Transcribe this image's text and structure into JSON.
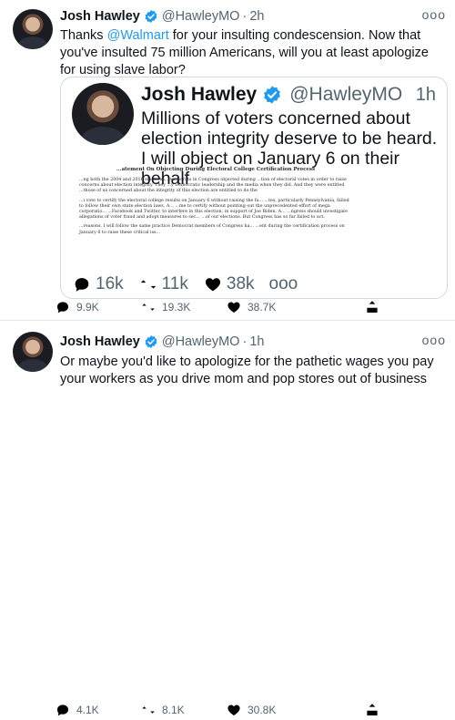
{
  "colors": {
    "link": "#1d9bf0",
    "verified": "#1d9bf0",
    "muted": "#536471",
    "text": "#0f1419"
  },
  "tweets": [
    {
      "name": "Josh Hawley",
      "handle": "@HawleyMO",
      "dot": "·",
      "time": "2h",
      "more": "ooo",
      "text_before": "Thanks ",
      "mention": "@Walmart",
      "text_after": " for your insulting condescension. Now that you've insulted 75 million Americans, will you at least apologize for using slave labor?",
      "quote": {
        "name": "Josh Hawley",
        "handle": "@HawleyMO",
        "time": "1h",
        "text": "Millions of voters concerned about election integrity deserve to be heard. I will object on January 6 on their behalf",
        "doc_title": "...atement On Objecting During Electoral College Certification Process",
        "doc_paragraphs": [
          "...ng both the 2004 and 2016 elections, Democrats in Congress objected during ...tion of electoral votes in order to raise concerns about election integrity. They ...y Democratic leadership and the media when they did. And they were entitled ...those of us concerned about the integrity of this election are entitled to do the",
          "...i vote to certify the electoral college results on January 6 without raising the fa... ...tes, particularly Pennsylvania, failed to follow their own state election laws. A... ...me to certify without pointing out the unprecedented effort of mega corporatio... ...Facebook and Twitter, to interfere in this election, in support of Joe Biden. A... ...ngress should investigate allegations of voter fraud and adopt measures to sec... ...of our elections. But Congress has so far failed to act.",
          "...reasons, I will follow the same practice Democrat members of Congress ha... ...ent during the certification process on January 6 to raise these critical iss..."
        ],
        "stats": {
          "replies": "16k",
          "retweets": "11k",
          "likes": "38k",
          "more": "ooo"
        }
      },
      "actions": {
        "replies": "9.9K",
        "retweets": "19.3K",
        "likes": "38.7K"
      }
    },
    {
      "name": "Josh Hawley",
      "handle": "@HawleyMO",
      "dot": "·",
      "time": "1h",
      "more": "ooo",
      "text": "Or maybe you'd like to apologize for the pathetic wages you pay your workers as you drive mom and pop stores out of business",
      "actions": {
        "replies": "4.1K",
        "retweets": "8.1K",
        "likes": "30.8K"
      }
    }
  ]
}
